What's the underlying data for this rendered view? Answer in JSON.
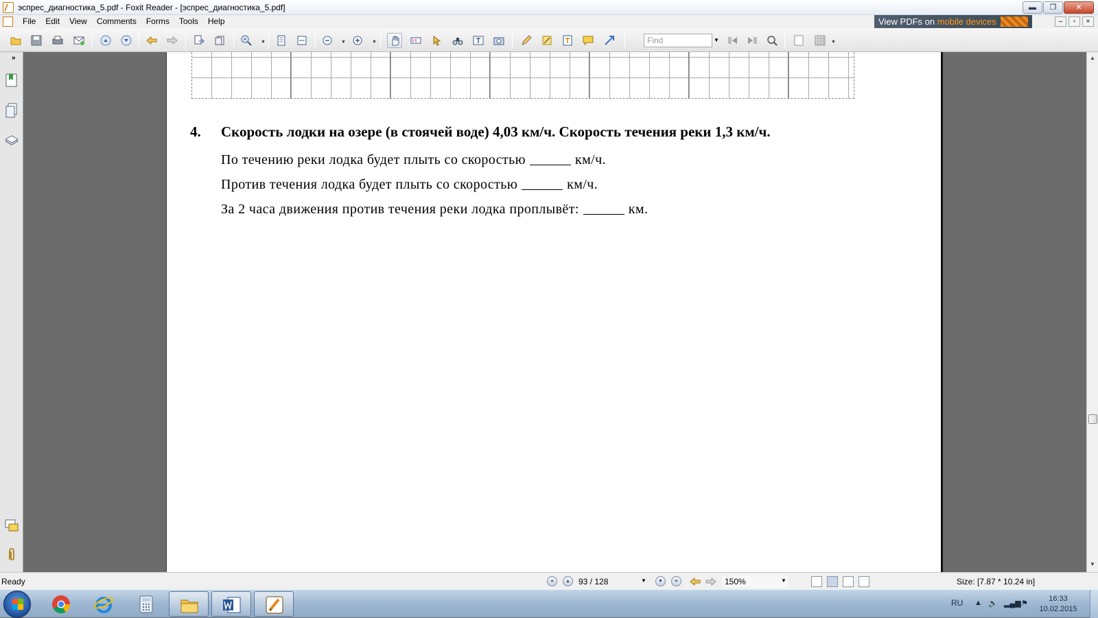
{
  "window": {
    "title": "эспрес_диагностика_5.pdf - Foxit Reader - [эспрес_диагностика_5.pdf]",
    "minimize": "▬",
    "restore": "❐",
    "close": "✕"
  },
  "menu": {
    "items": [
      {
        "label": "File",
        "name": "menu-file"
      },
      {
        "label": "Edit",
        "name": "menu-edit"
      },
      {
        "label": "View",
        "name": "menu-view"
      },
      {
        "label": "Comments",
        "name": "menu-comments"
      },
      {
        "label": "Forms",
        "name": "menu-forms"
      },
      {
        "label": "Tools",
        "name": "menu-tools"
      },
      {
        "label": "Help",
        "name": "menu-help"
      }
    ],
    "ad_text": "View PDFs on ",
    "ad_highlight": "mobile devices"
  },
  "toolbar": {
    "find_placeholder": "Find"
  },
  "document": {
    "question_number": "4.",
    "question_text": "Скорость лодки на озере (в стоячей воде) 4,03 км/ч. Скорость течения реки 1,3 км/ч.",
    "lines": [
      {
        "before": "По течению реки лодка будет плыть со скоростью",
        "after": "км/ч."
      },
      {
        "before": "Против течения лодка будет плыть со скоростью",
        "after": "км/ч."
      },
      {
        "before": "За 2 часа движения против течения реки лодка проплывёт:",
        "after": "км."
      }
    ]
  },
  "status": {
    "ready": "Ready",
    "page_indicator": "93 / 128",
    "zoom": "150%",
    "size": "Size: [7.87 * 10.24 in]"
  },
  "taskbar": {
    "lang": "RU",
    "time": "16:33",
    "date": "10.02.2015"
  },
  "colors": {
    "accent_orange": "#ff9a1a",
    "page_bg": "#ffffff",
    "doc_bg": "#6c6c6c"
  }
}
